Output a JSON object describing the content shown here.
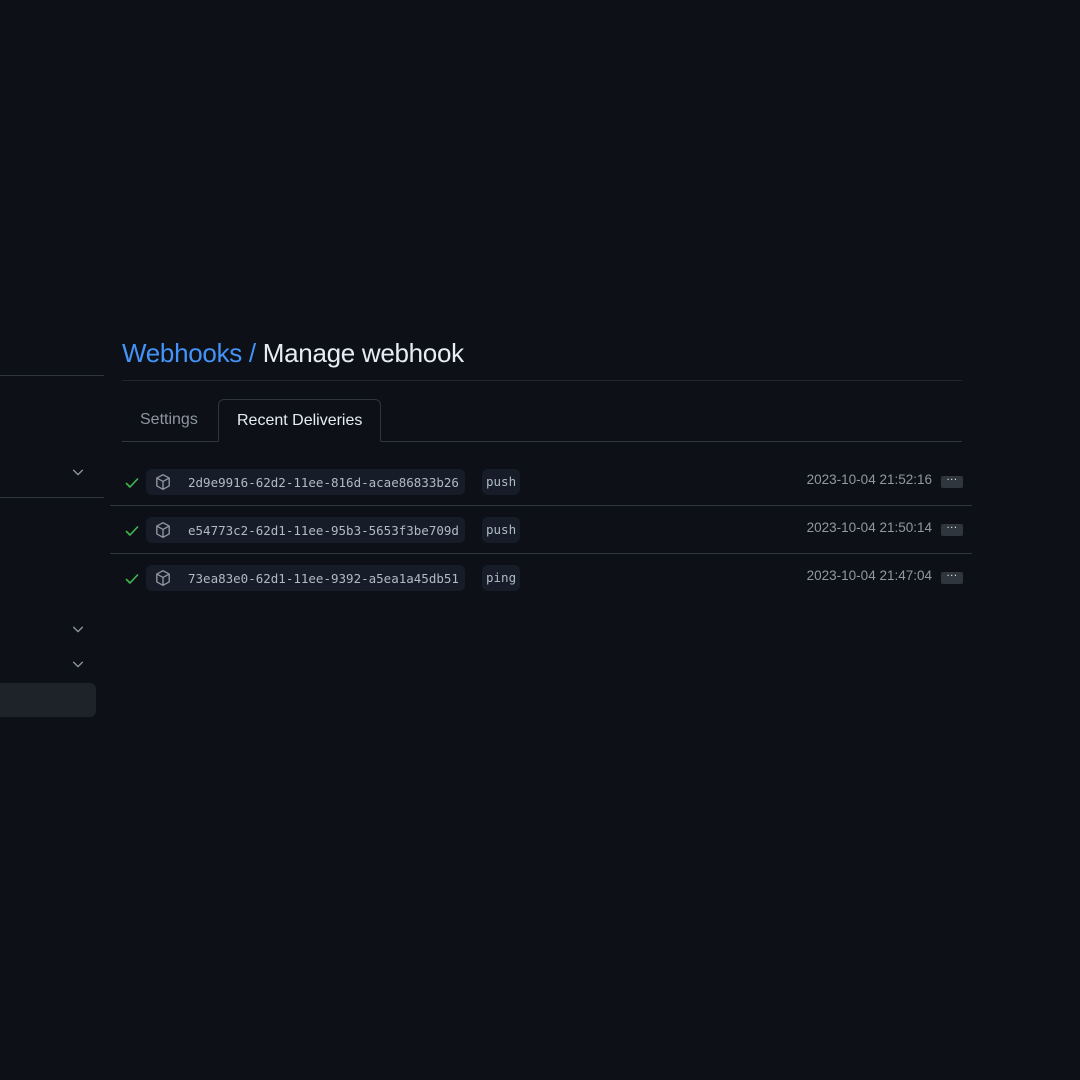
{
  "header": {
    "breadcrumb_link": "Webhooks",
    "breadcrumb_separator": " / ",
    "title": "Manage webhook"
  },
  "tabs": [
    {
      "label": "Settings",
      "active": false
    },
    {
      "label": "Recent Deliveries",
      "active": true
    }
  ],
  "deliveries": [
    {
      "status_icon": "check-icon",
      "type_icon": "package-icon",
      "guid": "2d9e9916-62d2-11ee-816d-acae86833b26",
      "event": "push",
      "timestamp": "2023-10-04 21:52:16",
      "more_label": "···"
    },
    {
      "status_icon": "check-icon",
      "type_icon": "package-icon",
      "guid": "e54773c2-62d1-11ee-95b3-5653f3be709d",
      "event": "push",
      "timestamp": "2023-10-04 21:50:14",
      "more_label": "···"
    },
    {
      "status_icon": "check-icon",
      "type_icon": "package-icon",
      "guid": "73ea83e0-62d1-11ee-9392-a5ea1a45db51",
      "event": "ping",
      "timestamp": "2023-10-04 21:47:04",
      "more_label": "···"
    }
  ],
  "colors": {
    "background": "#0d1117",
    "link": "#4493f8",
    "success": "#3fb950",
    "border": "#30363d"
  }
}
